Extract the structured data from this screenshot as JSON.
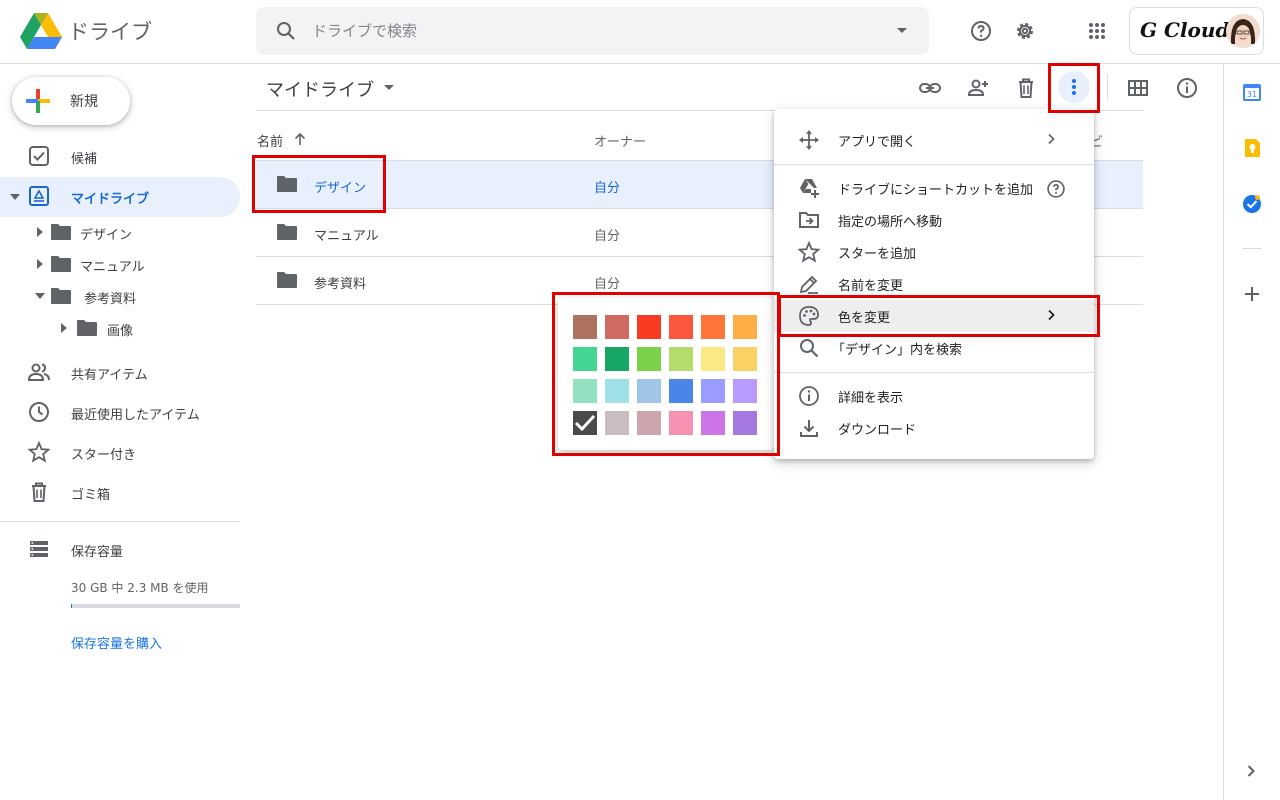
{
  "header": {
    "app_title": "ドライブ",
    "search_placeholder": "ドライブで検索",
    "account_brand": "G Cloud"
  },
  "sidebar": {
    "new_label": "新規",
    "items": [
      {
        "label": "候補",
        "icon": "suggested-icon"
      },
      {
        "label": "マイドライブ",
        "icon": "my-drive-icon",
        "active": true
      },
      {
        "label": "共有アイテム",
        "icon": "shared-people-icon"
      },
      {
        "label": "最近使用したアイテム",
        "icon": "clock-icon"
      },
      {
        "label": "スター付き",
        "icon": "star-icon"
      },
      {
        "label": "ゴミ箱",
        "icon": "trash-icon"
      }
    ],
    "tree": [
      {
        "label": "デザイン",
        "expanded": false
      },
      {
        "label": "マニュアル",
        "expanded": false
      },
      {
        "label": "参考資料",
        "expanded": true
      },
      {
        "label": "画像",
        "expanded": false
      }
    ],
    "storage": {
      "label": "保存容量",
      "usage": "30 GB 中 2.3 MB を使用",
      "used_fraction": 0.0001,
      "buy_label": "保存容量を購入"
    }
  },
  "main": {
    "breadcrumb": "マイドライブ",
    "columns": {
      "name": "名前",
      "owner": "オーナー",
      "last": "ビ"
    },
    "rows": [
      {
        "name": "デザイン",
        "owner": "自分",
        "selected": true
      },
      {
        "name": "マニュアル",
        "owner": "自分",
        "selected": false
      },
      {
        "name": "参考資料",
        "owner": "自分",
        "selected": false
      }
    ]
  },
  "context_menu": {
    "items": [
      {
        "label": "アプリで開く",
        "icon": "open-with-icon",
        "submenu": true
      },
      {
        "label": "ドライブにショートカットを追加",
        "icon": "drive-shortcut-icon",
        "help": true
      },
      {
        "label": "指定の場所へ移動",
        "icon": "move-to-icon"
      },
      {
        "label": "スターを追加",
        "icon": "star-icon"
      },
      {
        "label": "名前を変更",
        "icon": "pencil-icon"
      },
      {
        "label": "色を変更",
        "icon": "palette-icon",
        "submenu": true,
        "highlighted": true
      },
      {
        "label": "「デザイン」内を検索",
        "icon": "search-icon"
      },
      {
        "label": "詳細を表示",
        "icon": "info-icon"
      },
      {
        "label": "ダウンロード",
        "icon": "download-icon"
      }
    ]
  },
  "color_palette": {
    "selected_index": 18,
    "colors": [
      "#ac725e",
      "#d06b64",
      "#f83a22",
      "#fa573c",
      "#ff7537",
      "#ffad46",
      "#42d692",
      "#16a765",
      "#7bd148",
      "#b3dc6c",
      "#fbe983",
      "#fad165",
      "#92e1c0",
      "#9fe1e7",
      "#9fc6e7",
      "#4986e7",
      "#9a9cff",
      "#b99aff",
      "#8f8f8f",
      "#cabdbf",
      "#cca6ac",
      "#f691b2",
      "#cd74e6",
      "#a47ae2"
    ]
  }
}
